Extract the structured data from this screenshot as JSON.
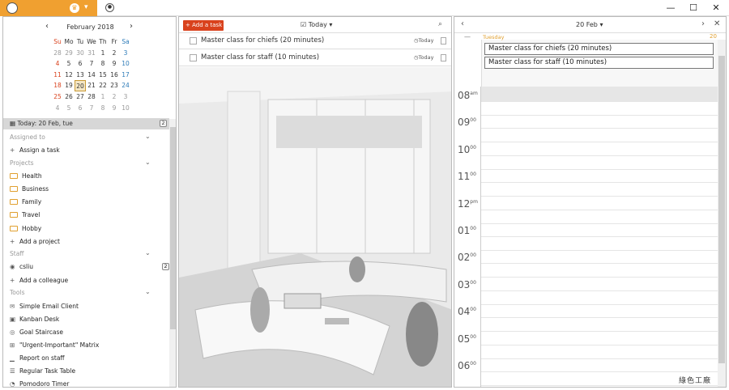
{
  "window": {
    "minimize": "—",
    "maximize": "☐",
    "close": "✕"
  },
  "calendar": {
    "month_label": "February 2018",
    "weekdays": [
      "Su",
      "Mo",
      "Tu",
      "We",
      "Th",
      "Fr",
      "Sa"
    ],
    "weeks": [
      [
        "28",
        "29",
        "30",
        "31",
        "1",
        "2",
        "3"
      ],
      [
        "4",
        "5",
        "6",
        "7",
        "8",
        "9",
        "10"
      ],
      [
        "11",
        "12",
        "13",
        "14",
        "15",
        "16",
        "17"
      ],
      [
        "18",
        "19",
        "20",
        "21",
        "22",
        "23",
        "24"
      ],
      [
        "25",
        "26",
        "27",
        "28",
        "1",
        "2",
        "3"
      ],
      [
        "4",
        "5",
        "6",
        "7",
        "8",
        "9",
        "10"
      ]
    ]
  },
  "today_bar": {
    "label": "Today: 20 Feb, tue",
    "count": "2"
  },
  "sections": {
    "assigned": "Assigned to",
    "assign_task": "Assign a task",
    "projects": "Projects",
    "projects_items": [
      "Health",
      "Business",
      "Family",
      "Travel",
      "Hobby"
    ],
    "add_project": "Add a project",
    "staff": "Staff",
    "staff_user": "csliu",
    "staff_count": "2",
    "add_colleague": "Add a colleague",
    "tools": "Tools",
    "tools_items": [
      "Simple Email Client",
      "Kanban Desk",
      "Goal Staircase",
      "\"Urgent-Important\" Matrix",
      "Report on staff",
      "Regular Task Table",
      "Pomodoro Timer"
    ]
  },
  "middle": {
    "add_task": "+ Add a task",
    "filter": "Today",
    "tasks": [
      {
        "title": "Master class for chiefs (20 minutes)",
        "due": "Today"
      },
      {
        "title": "Master class for staff (10 minutes)",
        "due": "Today"
      }
    ]
  },
  "right": {
    "date": "20 Feb",
    "weekday": "Tuesday",
    "daynum": "20",
    "events": [
      "Master class for chiefs (20 minutes)",
      "Master class for staff (10 minutes)"
    ],
    "hours": [
      {
        "h": "08",
        "s": "am"
      },
      {
        "h": "09",
        "s": "00"
      },
      {
        "h": "10",
        "s": "00"
      },
      {
        "h": "11",
        "s": "00"
      },
      {
        "h": "12",
        "s": "pm"
      },
      {
        "h": "01",
        "s": "00"
      },
      {
        "h": "02",
        "s": "00"
      },
      {
        "h": "03",
        "s": "00"
      },
      {
        "h": "04",
        "s": "00"
      },
      {
        "h": "05",
        "s": "00"
      },
      {
        "h": "06",
        "s": "00"
      }
    ]
  },
  "watermark": "綠色工廠",
  "colors": {
    "accent": "#f0a030",
    "add_button": "#d9421d",
    "sunday": "#d9421d",
    "saturday": "#2d7bb8"
  }
}
